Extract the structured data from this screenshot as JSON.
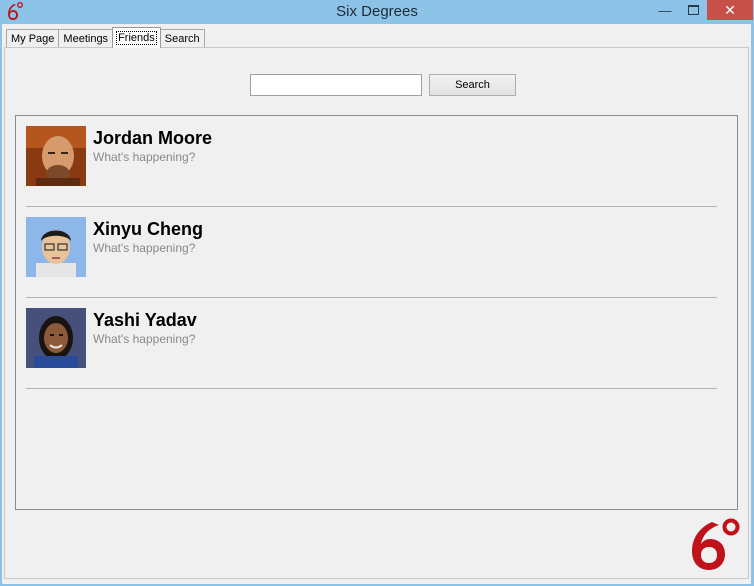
{
  "window": {
    "title": "Six Degrees"
  },
  "tabs": [
    {
      "label": "My Page"
    },
    {
      "label": "Meetings"
    },
    {
      "label": "Friends"
    },
    {
      "label": "Search"
    }
  ],
  "search": {
    "button_label": "Search",
    "value": ""
  },
  "friends": [
    {
      "name": "Jordan Moore",
      "status": "What's happening?"
    },
    {
      "name": "Xinyu Cheng",
      "status": "What's happening?"
    },
    {
      "name": "Yashi Yadav",
      "status": "What's happening?"
    }
  ],
  "colors": {
    "titlebar": "#8cc3e6",
    "close": "#c7504b",
    "brand_red": "#c0121b"
  }
}
